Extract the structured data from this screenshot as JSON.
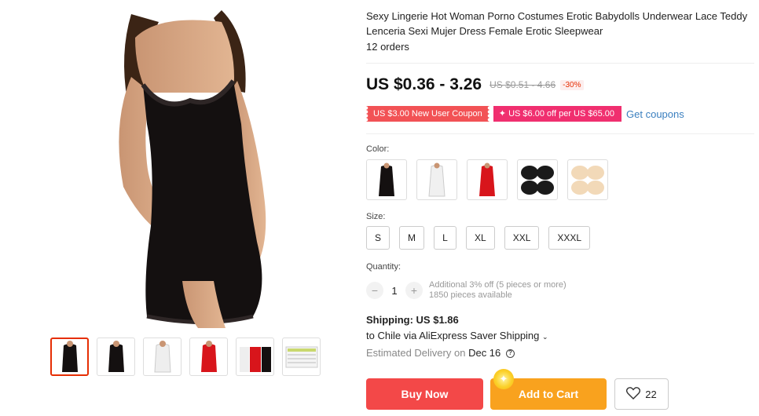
{
  "product": {
    "title": "Sexy Lingerie Hot Woman Porno Costumes Erotic Babydolls Underwear Lace Teddy Lenceria Sexi Mujer Dress Female Erotic Sleepwear",
    "orders": "12 orders",
    "price": "US $0.36 - 3.26",
    "original_price": "US $0.51 - 4.66",
    "discount": "-30%"
  },
  "coupons": {
    "new_user": "US $3.00 New User Coupon",
    "store": "US $6.00 off per US $65.00",
    "get_coupons": "Get coupons"
  },
  "color": {
    "label": "Color:",
    "options": [
      "black-dress",
      "white-dress",
      "red-dress",
      "black-pads",
      "nude-pads"
    ]
  },
  "size": {
    "label": "Size:",
    "options": [
      "S",
      "M",
      "L",
      "XL",
      "XXL",
      "XXXL"
    ]
  },
  "quantity": {
    "label": "Quantity:",
    "value": "1",
    "minus": "−",
    "plus": "+",
    "note": "Additional 3% off (5 pieces or more)",
    "available": "1850 pieces available"
  },
  "shipping": {
    "cost": "Shipping: US $1.86",
    "to": "to Chile via AliExpress Saver Shipping",
    "delivery_label": "Estimated Delivery on",
    "delivery_date": "Dec 16",
    "help": "?"
  },
  "actions": {
    "buy_now": "Buy Now",
    "add_to_cart": "Add to Cart",
    "wishlist_count": "22"
  },
  "colors": {
    "black": "#1a1a1a",
    "red": "#d8151b",
    "accent_red": "#f34848",
    "accent_orange": "#f9a21e",
    "link": "#3a7fbf"
  }
}
